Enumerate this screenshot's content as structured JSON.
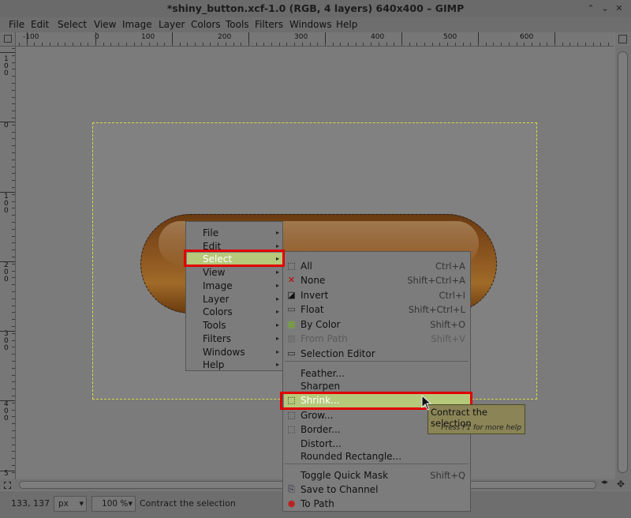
{
  "window": {
    "title": "*shiny_button.xcf-1.0 (RGB, 4 layers) 640x400 – GIMP",
    "controls": [
      "⌃",
      "⌄",
      "✕"
    ]
  },
  "menubar": [
    "File",
    "Edit",
    "Select",
    "View",
    "Image",
    "Layer",
    "Colors",
    "Tools",
    "Filters",
    "Windows",
    "Help"
  ],
  "hruler_labels": [
    "-100",
    "0",
    "100",
    "200",
    "300",
    "400",
    "500",
    "600"
  ],
  "vruler_labels": [
    "1\n0\n0",
    "0",
    "1\n0\n0",
    "2\n0\n0",
    "3\n0\n0",
    "4\n0\n0",
    "5"
  ],
  "context_menu": {
    "items": [
      {
        "label": "File"
      },
      {
        "label": "Edit"
      },
      {
        "label": "Select",
        "active": true
      },
      {
        "label": "View"
      },
      {
        "label": "Image"
      },
      {
        "label": "Layer"
      },
      {
        "label": "Colors"
      },
      {
        "label": "Tools"
      },
      {
        "label": "Filters"
      },
      {
        "label": "Windows"
      },
      {
        "label": "Help"
      }
    ],
    "submenu_arrow": "▸"
  },
  "select_menu": {
    "items": [
      {
        "label": "All",
        "shortcut": "Ctrl+A",
        "icon": "select-all-icon"
      },
      {
        "label": "None",
        "shortcut": "Shift+Ctrl+A",
        "icon": "select-none-icon"
      },
      {
        "label": "Invert",
        "shortcut": "Ctrl+I",
        "icon": "invert-icon"
      },
      {
        "label": "Float",
        "shortcut": "Shift+Ctrl+L",
        "icon": "float-icon"
      },
      {
        "label": "By Color",
        "shortcut": "Shift+O",
        "icon": "by-color-icon"
      },
      {
        "label": "From Path",
        "shortcut": "Shift+V",
        "icon": "from-path-icon",
        "disabled": true
      },
      {
        "label": "Selection Editor",
        "shortcut": "",
        "icon": "selection-editor-icon"
      },
      {
        "label": "Feather...",
        "shortcut": "",
        "icon": ""
      },
      {
        "label": "Sharpen",
        "shortcut": "",
        "icon": ""
      },
      {
        "label": "Shrink...",
        "shortcut": "",
        "icon": "shrink-icon",
        "active": true
      },
      {
        "label": "Grow...",
        "shortcut": "",
        "icon": "grow-icon"
      },
      {
        "label": "Border...",
        "shortcut": "",
        "icon": "border-icon"
      },
      {
        "label": "Distort...",
        "shortcut": "",
        "icon": ""
      },
      {
        "label": "Rounded Rectangle...",
        "shortcut": "",
        "icon": ""
      },
      {
        "label": "Toggle Quick Mask",
        "shortcut": "Shift+Q",
        "icon": ""
      },
      {
        "label": "Save to Channel",
        "shortcut": "",
        "icon": "save-channel-icon"
      },
      {
        "label": "To Path",
        "shortcut": "",
        "icon": "to-path-icon"
      }
    ]
  },
  "tooltip": {
    "text": "Contract the selection",
    "help": "Press F1 for more help"
  },
  "statusbar": {
    "coords": "133, 137",
    "unit": "px",
    "zoom": "100 %",
    "message": "Contract the selection"
  },
  "colors": {
    "highlight": "#b6c87a",
    "annotation_red": "#e00000",
    "selection_marquee": "#d8d84a"
  }
}
